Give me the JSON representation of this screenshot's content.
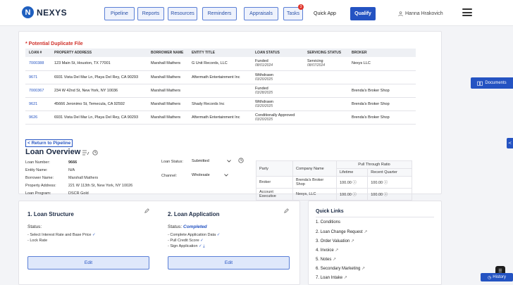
{
  "brand": {
    "logo_letter": "N",
    "name": "NEXYS"
  },
  "nav": {
    "pipeline": "Pipeline",
    "reports": "Reports",
    "resources": "Resources",
    "reminders": "Reminders",
    "appraisals": "Appraisals",
    "tasks": "Tasks",
    "tasks_badge": "3",
    "quick_app": "Quick App",
    "qualify": "Qualify",
    "user": "Hanna Hrakovich"
  },
  "duplicate": {
    "title": "* Potential Duplicate File",
    "headers": [
      "LOAN #",
      "PROPERTY ADDRESS",
      "BORROWER NAME",
      "ENTITY TITLE",
      "LOAN STATUS",
      "SERVICING STATUS",
      "BROKER"
    ],
    "rows": [
      {
        "loan": "7000388",
        "address": "123 Main St, Houston, TX 77001",
        "borrower": "Marshall Mathers",
        "entity": "G Unit Records, LLC",
        "status": "Funded",
        "status_date": "08/01/2024",
        "servicing": "Servicing",
        "servicing_date": "08/07/2024",
        "broker": "Nexys LLC"
      },
      {
        "loan": "9671",
        "address": "6931 Vista Del Mar Ln, Playa Del Rey, CA 90293",
        "borrower": "Marshall Mathers",
        "entity": "Aftermath Entertainment Inc",
        "status": "Withdrawn",
        "status_date": "03/20/2025",
        "servicing": "",
        "servicing_date": "",
        "broker": ""
      },
      {
        "loan": "7000367",
        "address": "234 W 42nd St, New York, NY 10036",
        "borrower": "Marshall Mathers",
        "entity": "",
        "status": "Funded",
        "status_date": "03/28/2025",
        "servicing": "",
        "servicing_date": "",
        "broker": "Brenda's Broker Shop"
      },
      {
        "loan": "9621",
        "address": "45666 Jeronimo St, Temecula, CA 92592",
        "borrower": "Marshall Mathers",
        "entity": "Shady Records Inc",
        "status": "Withdrawn",
        "status_date": "03/20/2025",
        "servicing": "",
        "servicing_date": "",
        "broker": "Brenda's Broker Shop"
      },
      {
        "loan": "9626",
        "address": "6931 Vista Del Mar Ln, Playa Del Rey, CA 90293",
        "borrower": "Marshall Mathers",
        "entity": "Aftermath Entertainment Inc",
        "status": "Conditionally Approved",
        "status_date": "03/20/2025",
        "servicing": "",
        "servicing_date": "",
        "broker": "Brenda's Broker Shop"
      }
    ]
  },
  "overview": {
    "return_link": "< Return to Pipeline",
    "title": "Loan Overview",
    "loan_number_label": "Loan Number:",
    "loan_number": "9666",
    "entity_label": "Entity Name:",
    "entity": "N/A",
    "borrower_label": "Borrower Name:",
    "borrower": "Marshall Mathers",
    "address_label": "Property Address:",
    "address": "221 W 113th St, New York, NY 10026",
    "program_label": "Loan Program:",
    "program": "DSCR Gold",
    "status_label": "Loan Status:",
    "status": "Submitted",
    "channel_label": "Channel:",
    "channel": "Wholesale"
  },
  "pull_through": {
    "h_party": "Party",
    "h_company": "Company Name",
    "h_ratio": "Pull Through Ratio",
    "h_lifetime": "Lifetime",
    "h_recent": "Recent Quarter",
    "rows": [
      {
        "party": "Broker",
        "company": "Brenda's Broker Shop",
        "lifetime": "100.00",
        "recent": "100.00"
      },
      {
        "party": "Account Executive",
        "company": "Nexys, LLC",
        "lifetime": "100.00",
        "recent": "100.00"
      }
    ]
  },
  "structure": {
    "title": "1. Loan Structure",
    "status_label": "Status:",
    "item1": "- Select Interest Rate and Base Price",
    "item2": "- Lock Rate",
    "edit": "Edit"
  },
  "application": {
    "title": "2. Loan Application",
    "status_label": "Status:",
    "status": "Completed",
    "item1": "- Complete Application Data",
    "item2": "- Pull Credit Score",
    "item3": "- Sign Application",
    "edit": "Edit"
  },
  "quick_links": {
    "title": "Quick Links",
    "items": [
      "1. Conditions",
      "2. Loan Change Request",
      "3. Order Valuation",
      "4. Invoice",
      "5. Notes",
      "6. Secondary Marketing",
      "7. Loan Intake"
    ]
  },
  "side": {
    "documents": "Documents",
    "history": "History"
  }
}
